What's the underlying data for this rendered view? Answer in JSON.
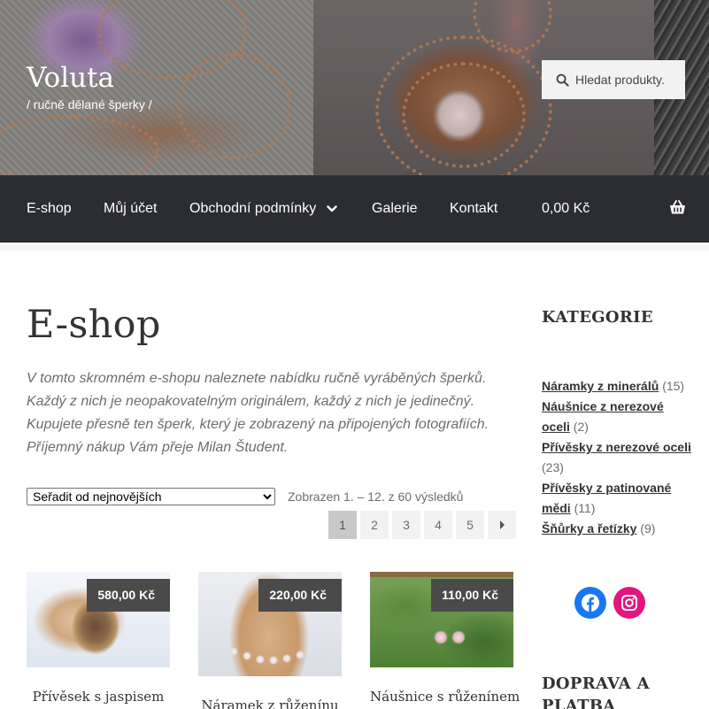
{
  "header": {
    "site_title": "Voluta",
    "site_description": "/ ručně dělané šperky /",
    "search_placeholder": "Hledat produkty."
  },
  "nav": {
    "items": [
      {
        "label": "E-shop"
      },
      {
        "label": "Můj účet"
      },
      {
        "label": "Obchodní podmínky"
      },
      {
        "label": "Galerie"
      },
      {
        "label": "Kontakt"
      }
    ],
    "cart_total": "0,00 Kč"
  },
  "main": {
    "title": "E-shop",
    "intro_lines": [
      "V tomto skromném e-shopu naleznete nabídku ručně vyráběných šperků.",
      "Každý z nich je neopakovatelným originálem, každý z nich je jedinečný.",
      "Kupujete přesně ten šperk, který je zobrazený na připojených fotografiích.",
      "Příjemný nákup Vám přeje Milan Študent."
    ],
    "sort_selected": "Seřadit od nejnovějších",
    "result_count": "Zobrazen 1. – 12. z 60 výsledků",
    "pagination": [
      "1",
      "2",
      "3",
      "4",
      "5"
    ],
    "pagination_current": "1",
    "products": [
      {
        "name": "Přívěsek s jaspisem",
        "price": "580,00 Kč"
      },
      {
        "name": "Náramek z růženínu",
        "price": "220,00 Kč"
      },
      {
        "name": "Náušnice s růženínem",
        "price": "110,00 Kč"
      }
    ]
  },
  "sidebar": {
    "categories_title": "KATEGORIE",
    "categories": [
      {
        "name": "Náramky z minerálů",
        "count": "(15)"
      },
      {
        "name": "Náušnice z nerezové oceli",
        "count": "(2)"
      },
      {
        "name": "Přívěsky z nerezové oceli",
        "count": "(23)"
      },
      {
        "name": "Přívěsky z patinované mědi",
        "count": "(11)"
      },
      {
        "name": "Šňůrky a řetízky",
        "count": "(9)"
      }
    ],
    "shipping_title": "DOPRAVA A PLATBA"
  },
  "colors": {
    "nav_background": "#2c2d33",
    "facebook": "#1877f2",
    "instagram": "#e4405f"
  }
}
